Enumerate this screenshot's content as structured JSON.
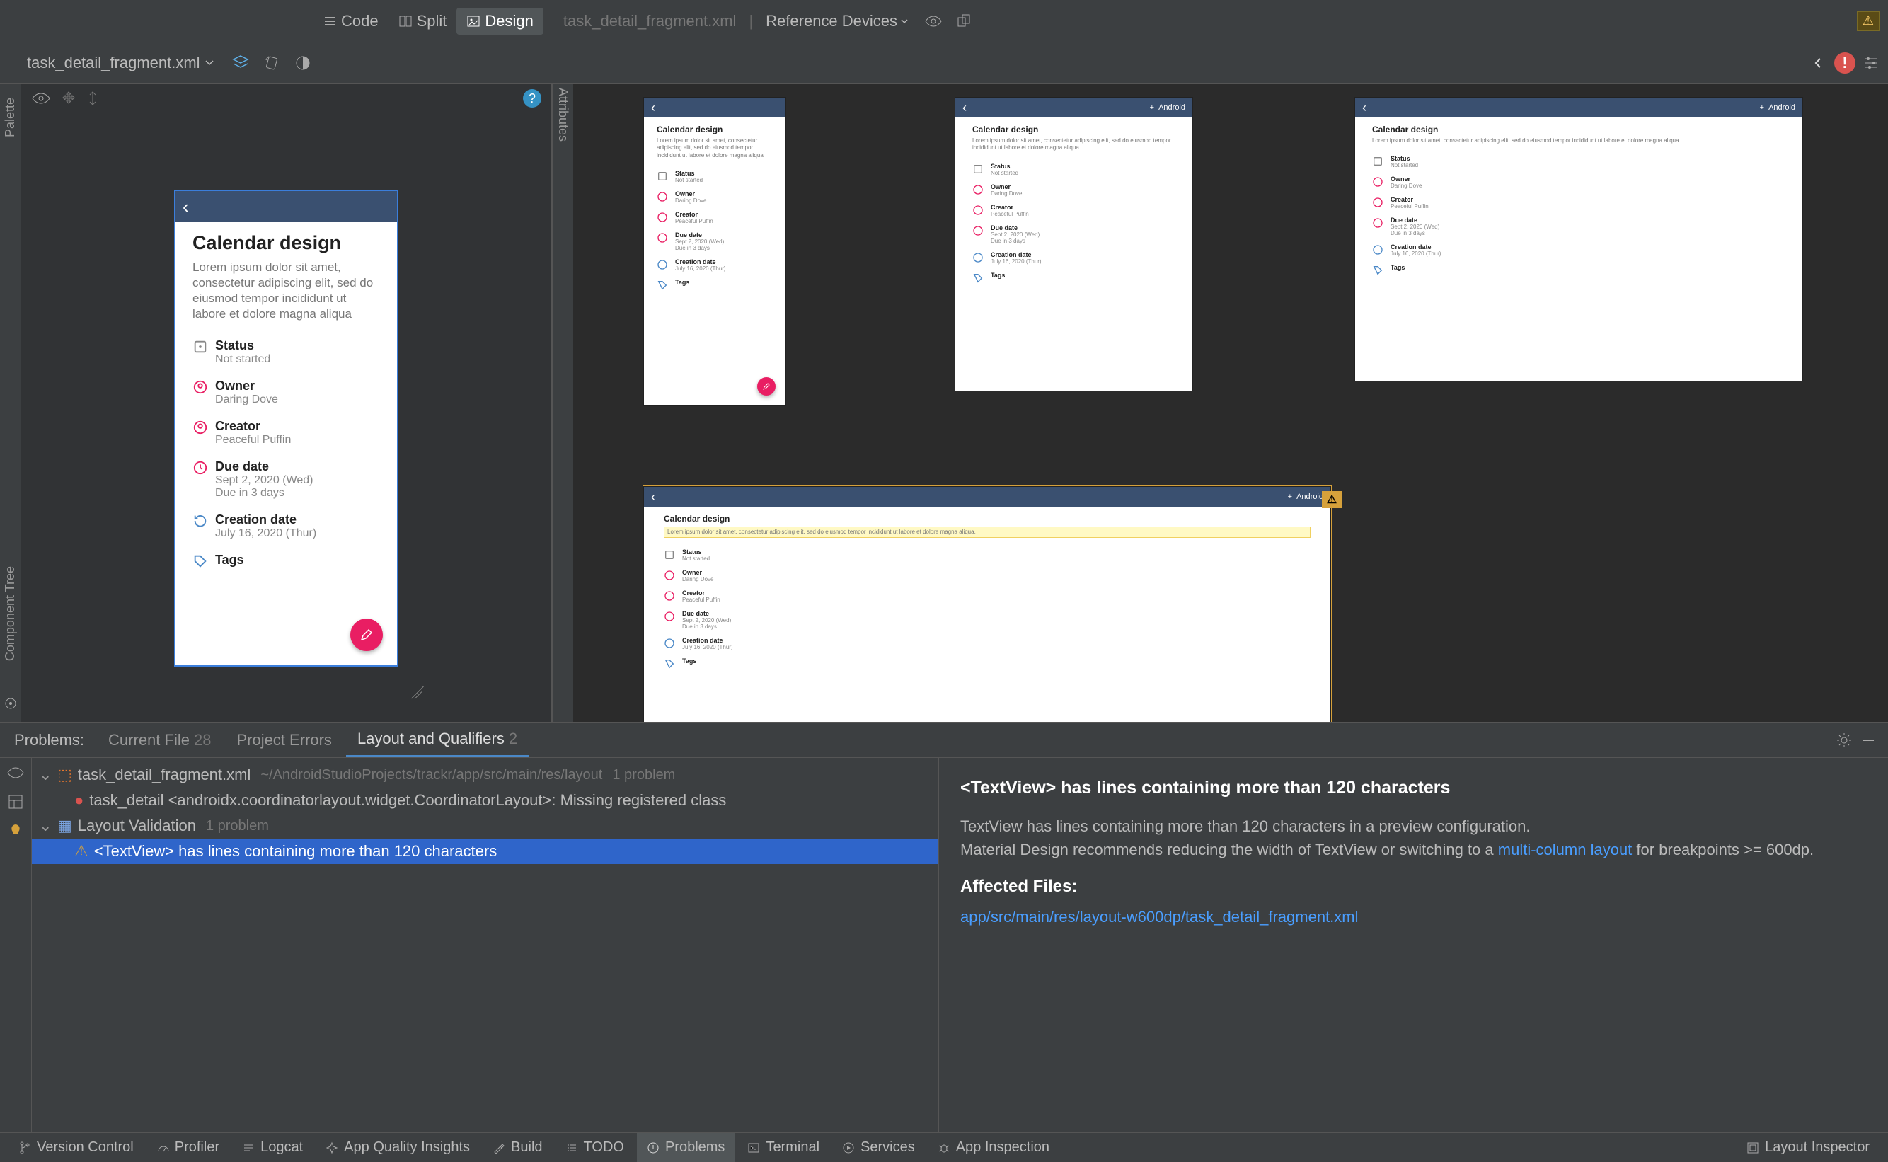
{
  "view_modes": {
    "code": "Code",
    "split": "Split",
    "design": "Design"
  },
  "breadcrumb": {
    "file": "task_detail_fragment.xml",
    "ref": "Reference Devices"
  },
  "file_tab": "task_detail_fragment.xml",
  "left_rail": {
    "palette": "Palette",
    "component_tree": "Component Tree"
  },
  "right_rail": {
    "attributes": "Attributes"
  },
  "task": {
    "title": "Calendar design",
    "desc_long": "Lorem ipsum dolor sit amet, consectetur adipiscing elit, sed do eiusmod tempor incididunt ut labore et dolore magna aliqua",
    "desc_wide": "Lorem ipsum dolor sit amet, consectetur adipiscing elit, sed do eiusmod tempor incididunt ut labore et dolore magna aliqua.",
    "status_l": "Status",
    "status_v": "Not started",
    "owner_l": "Owner",
    "owner_v": "Daring Dove",
    "creator_l": "Creator",
    "creator_v": "Peaceful Puffin",
    "due_l": "Due date",
    "due_v": "Sept 2, 2020 (Wed)",
    "due_v2": "Due in 3 days",
    "creation_l": "Creation date",
    "creation_v": "July 16, 2020 (Thur)",
    "tags_l": "Tags",
    "hdr_plus": "+",
    "hdr_android": "Android"
  },
  "problems": {
    "label": "Problems:",
    "tab_current": "Current File",
    "count_current": "28",
    "tab_project": "Project Errors",
    "tab_layout": "Layout and Qualifiers",
    "count_layout": "2",
    "tree": {
      "file": "task_detail_fragment.xml",
      "file_path": "~/AndroidStudioProjects/trackr/app/src/main/res/layout",
      "file_count": "1 problem",
      "err": "task_detail <androidx.coordinatorlayout.widget.CoordinatorLayout>: Missing registered class",
      "val_group": "Layout Validation",
      "val_count": "1 problem",
      "warn": "<TextView> has lines containing more than 120 characters"
    },
    "detail": {
      "title": "<TextView> has lines containing more than 120 characters",
      "p1a": "TextView has lines containing more than 120 characters in a preview configuration.",
      "p1b": "Material Design recommends reducing the width of TextView or switching to a ",
      "link": "multi-column layout",
      "p1c": " for breakpoints >= 600dp.",
      "affected": "Affected Files:",
      "file_link": "app/src/main/res/layout-w600dp/task_detail_fragment.xml"
    }
  },
  "status": {
    "vcs": "Version Control",
    "profiler": "Profiler",
    "logcat": "Logcat",
    "aqi": "App Quality Insights",
    "build": "Build",
    "todo": "TODO",
    "problems": "Problems",
    "terminal": "Terminal",
    "services": "Services",
    "inspection": "App Inspection",
    "layout_inspector": "Layout Inspector"
  }
}
